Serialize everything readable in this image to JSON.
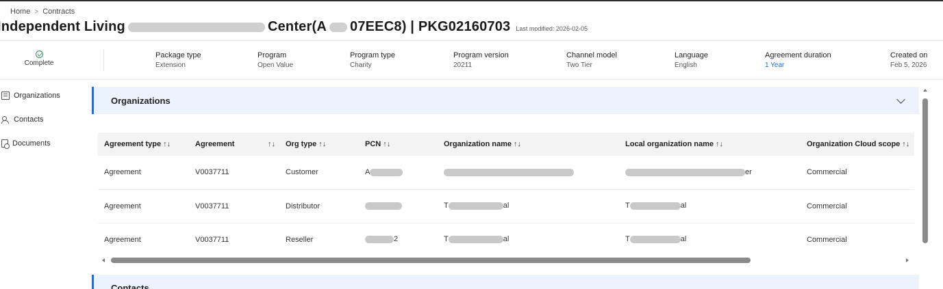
{
  "breadcrumb": {
    "home": "Home",
    "separator": ">",
    "current": "Contracts"
  },
  "header": {
    "title_prefix": "Independent Living",
    "title_middle": "Center(A",
    "title_suffix": "07EEC8) | PKG02160703",
    "last_modified": "Last modified: 2026-02-05"
  },
  "summary": {
    "status": "Complete",
    "fields": [
      {
        "label": "Package type",
        "value": "Extension"
      },
      {
        "label": "Program",
        "value": "Open Value"
      },
      {
        "label": "Program type",
        "value": "Charity"
      },
      {
        "label": "Program version",
        "value": "20211"
      },
      {
        "label": "Channel model",
        "value": "Two Tier"
      },
      {
        "label": "Language",
        "value": "English"
      },
      {
        "label": "Agreement duration",
        "value": "1 Year"
      },
      {
        "label": "Created on",
        "value": "Feb 5, 2026"
      }
    ]
  },
  "sidebar": {
    "items": [
      {
        "label": "Organizations",
        "icon": "organizations-icon"
      },
      {
        "label": "Contacts",
        "icon": "contacts-icon"
      },
      {
        "label": "Documents",
        "icon": "documents-icon"
      }
    ]
  },
  "organizations_section": {
    "title": "Organizations",
    "columns": [
      "Agreement type",
      "Agreement",
      "Org type",
      "PCN",
      "Organization name",
      "Local organization name",
      "Organization Cloud scope"
    ],
    "sort_glyph": "↑↓",
    "rows": [
      {
        "agreement_type": "Agreement",
        "agreement": "V0037711",
        "org_type": "Customer",
        "pcn_prefix": "A",
        "pcn_suffix": "",
        "org_prefix": "",
        "org_suffix": "",
        "local_prefix": "",
        "local_suffix": "er",
        "cloud_scope": "Commercial"
      },
      {
        "agreement_type": "Agreement",
        "agreement": "V0037711",
        "org_type": "Distributor",
        "pcn_prefix": "",
        "pcn_suffix": "",
        "org_prefix": "T",
        "org_suffix": "al",
        "local_prefix": "T",
        "local_suffix": "al",
        "cloud_scope": "Commercial"
      },
      {
        "agreement_type": "Agreement",
        "agreement": "V0037711",
        "org_type": "Reseller",
        "pcn_prefix": "",
        "pcn_suffix": "2",
        "org_prefix": "T",
        "org_suffix": "al",
        "local_prefix": "T",
        "local_suffix": "al",
        "cloud_scope": "Commercial"
      }
    ]
  },
  "contacts_section": {
    "title": "Contacts"
  }
}
